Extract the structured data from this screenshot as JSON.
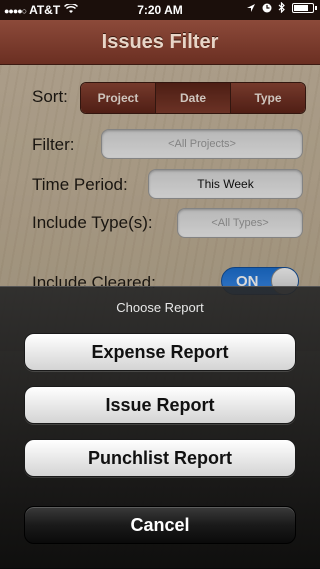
{
  "status_bar": {
    "carrier": "AT&T",
    "time": "7:20 AM",
    "battery_level": 0.8
  },
  "nav": {
    "title": "Issues Filter"
  },
  "form": {
    "sort_label": "Sort:",
    "sort_options": [
      "Project",
      "Date",
      "Type"
    ],
    "sort_selected": "Date",
    "filter_label": "Filter:",
    "filter_placeholder": "<All Projects>",
    "time_period_label": "Time Period:",
    "time_period_value": "This Week",
    "include_types_label": "Include Type(s):",
    "include_types_placeholder": "<All Types>",
    "include_cleared_label": "Include Cleared:",
    "include_cleared_toggle": "ON"
  },
  "action_sheet": {
    "title": "Choose Report",
    "buttons": [
      "Expense Report",
      "Issue Report",
      "Punchlist Report"
    ],
    "cancel": "Cancel"
  },
  "colors": {
    "nav_bar": "#7a3a2b",
    "toggle_on": "#2a7be0"
  },
  "icons": [
    "signal-icon",
    "wifi-icon",
    "location-icon",
    "clock-icon",
    "bluetooth-icon",
    "battery-icon"
  ]
}
